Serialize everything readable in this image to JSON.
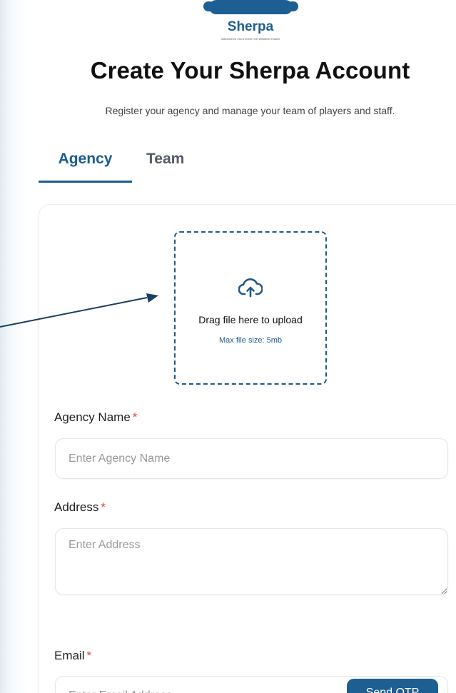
{
  "brand": {
    "name": "Sherpa",
    "tagline": "INNOVATIVE SOLUTIONS FOR WINNING TEAMS",
    "primary_color": "#1d5e93",
    "accent_color": "#e0453a"
  },
  "header": {
    "title": "Create Your Sherpa Account",
    "subtitle": "Register your agency and manage your team of players and staff."
  },
  "tabs": [
    {
      "label": "Agency",
      "active": true
    },
    {
      "label": "Team",
      "active": false
    }
  ],
  "upload": {
    "icon": "cloud-upload-icon",
    "text": "Drag file here to upload",
    "hint": "Max file size: 5mb"
  },
  "form": {
    "agency_name": {
      "label": "Agency Name",
      "required_mark": "*",
      "placeholder": "Enter Agency Name",
      "value": ""
    },
    "address": {
      "label": "Address",
      "required_mark": "*",
      "placeholder": "Enter Address",
      "value": ""
    },
    "email": {
      "label": "Email",
      "required_mark": "*",
      "placeholder": "Enter Email Address",
      "value": "",
      "otp_button": "Send OTP"
    }
  }
}
